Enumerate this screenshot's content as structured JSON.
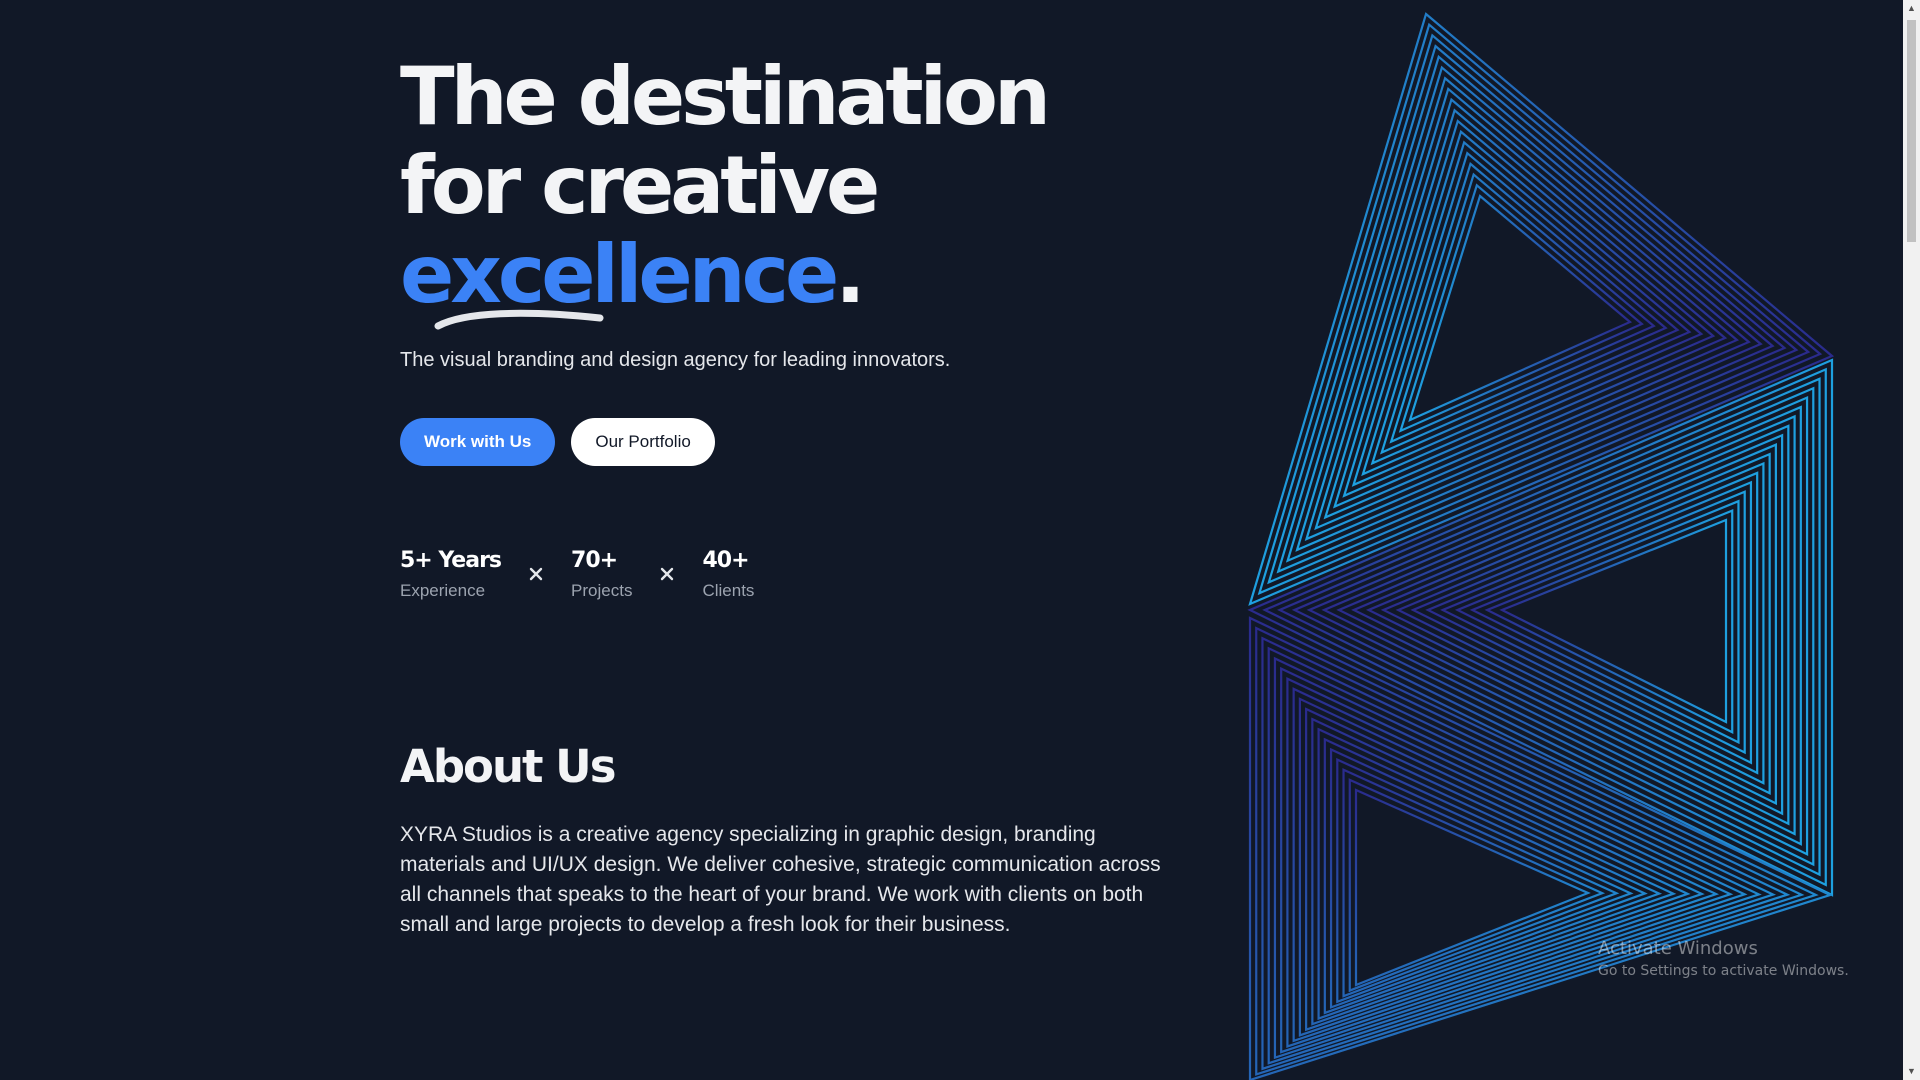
{
  "hero": {
    "line1": "The destination",
    "line2": "for creative",
    "accent_word": "excellence",
    "accent_punct": ".",
    "subtitle": "The visual branding and design agency for leading innovators."
  },
  "cta": {
    "primary_label": "Work with Us",
    "secondary_label": "Our Portfolio"
  },
  "stats": [
    {
      "value": "5+ Years",
      "label": "Experience"
    },
    {
      "value": "70+",
      "label": "Projects"
    },
    {
      "value": "40+",
      "label": "Clients"
    }
  ],
  "about": {
    "title": "About Us",
    "body": "XYRA Studios is a creative agency specializing in graphic design, branding materials and UI/UX design. We deliver cohesive, strategic communication across all channels that speaks to the heart of your brand. We work with clients on both small and large projects to develop a fresh look for their business."
  },
  "watermark": {
    "title": "Activate Windows",
    "subtitle": "Go to Settings to activate Windows."
  },
  "icons": {
    "separator": "x-cross-icon",
    "scroll_up": "chevron-up-icon",
    "scroll_down": "chevron-down-icon"
  },
  "colors": {
    "background": "#111827",
    "accent": "#3b82f6",
    "art_light": "#1ea0e0",
    "art_dark": "#2a2a8c"
  }
}
